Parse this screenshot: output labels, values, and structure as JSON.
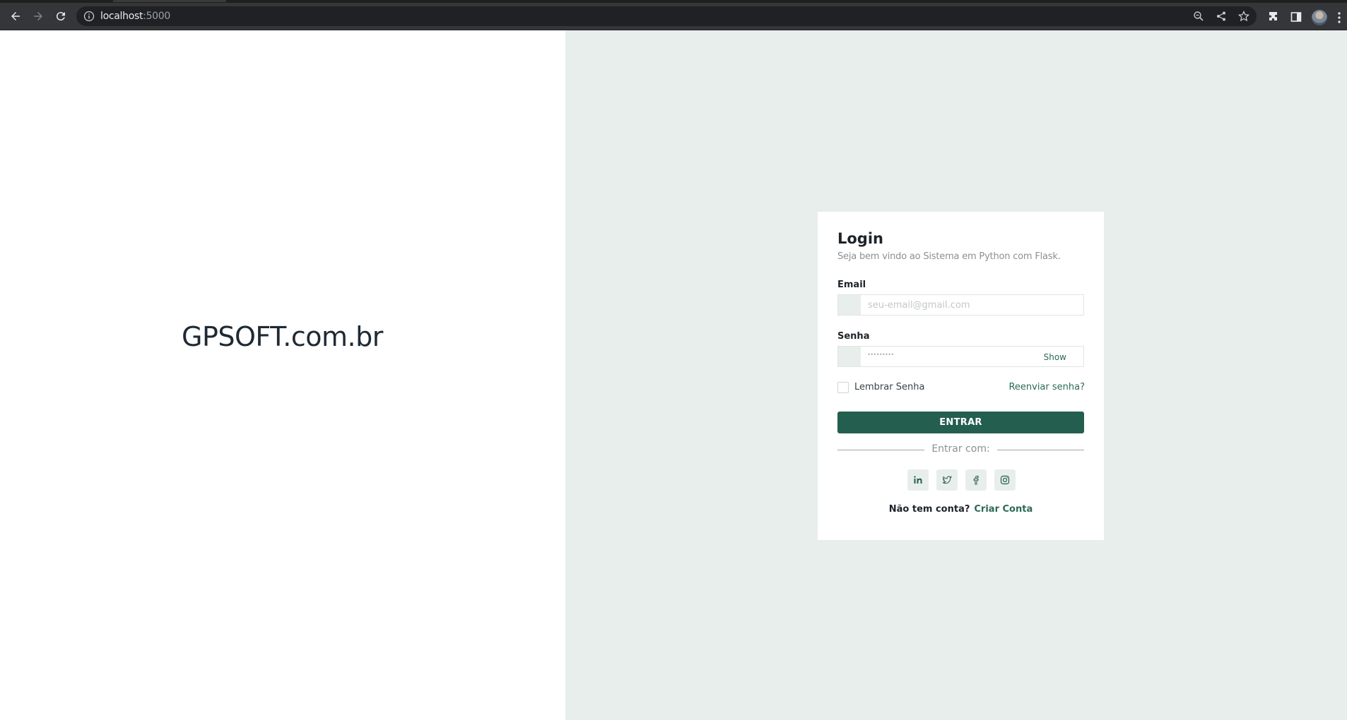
{
  "browser": {
    "url_host": "localhost",
    "url_port": ":5000"
  },
  "brand": {
    "text": "GPSOFT.com.br"
  },
  "login": {
    "title": "Login",
    "subtitle": "Seja bem vindo ao Sistema em Python com Flask.",
    "email_label": "Email",
    "email_placeholder": "seu-email@gmail.com",
    "password_label": "Senha",
    "password_mask": "•••••••••",
    "show_label": "Show",
    "remember_label": "Lembrar Senha",
    "remember_checked": false,
    "forgot_label": "Reenviar senha?",
    "submit_label": "ENTRAR",
    "divider_label": "Entrar com:",
    "social_icons": [
      "linkedin-icon",
      "twitter-icon",
      "facebook-icon",
      "instagram-icon"
    ],
    "signup_question": "Não tem conta?",
    "signup_link": "Criar Conta"
  },
  "colors": {
    "accent": "#245e4e",
    "right_panel_bg": "#e8eeeb",
    "browser_toolbar": "#35363a"
  }
}
